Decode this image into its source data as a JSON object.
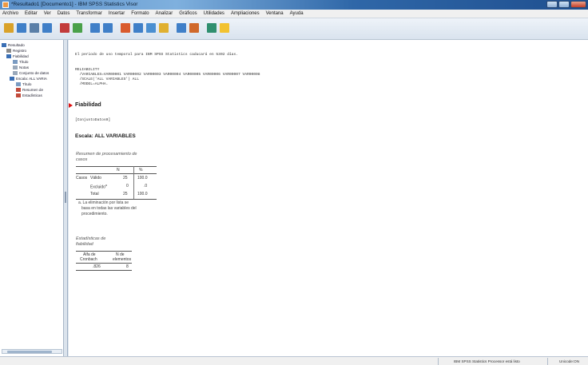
{
  "window": {
    "title": "*Resultado1 [Documento1] - IBM SPSS Statistics Visor",
    "controls": [
      "minimize",
      "maximize",
      "close"
    ]
  },
  "menu": [
    "Archivo",
    "Editar",
    "Ver",
    "Datos",
    "Transformar",
    "Insertar",
    "Formato",
    "Analizar",
    "Gráficos",
    "Utilidades",
    "Ampliaciones",
    "Ventana",
    "Ayuda"
  ],
  "toolbar": {
    "icons": [
      "open-icon",
      "save-icon",
      "print-icon",
      "print-preview-icon",
      "export-icon",
      "recall-dialog-icon",
      "undo-icon",
      "redo-icon",
      "goto-data-icon",
      "goto-case-icon",
      "variables-icon",
      "chart-icon",
      "select-cases-icon",
      "weight-icon",
      "show-all-icon",
      "new-output-icon"
    ],
    "colors": [
      "#d9a22a",
      "#3f7fc8",
      "#5a7fa8",
      "#3f7fc8",
      "#c23b3b",
      "#4aa14a",
      "#3f7fc8",
      "#3f7fc8",
      "#d95b2e",
      "#3f7fc8",
      "#4a8fd1",
      "#e0b030",
      "#3f7fc8",
      "#d0682a",
      "#2f8f6f",
      "#f2c230"
    ]
  },
  "nav": {
    "items": [
      {
        "label": "Resultado",
        "icon": "output-book-icon"
      },
      {
        "label": "Registro",
        "icon": "log-icon"
      },
      {
        "label": "Fiabilidad",
        "icon": "procedure-book-icon"
      },
      {
        "label": "Título",
        "icon": "title-icon"
      },
      {
        "label": "Notas",
        "icon": "notes-icon"
      },
      {
        "label": "Conjunto de datos",
        "icon": "dataset-icon"
      },
      {
        "label": "Escala: ALL VARIA",
        "icon": "scale-book-icon"
      },
      {
        "label": "Título",
        "icon": "title-icon"
      },
      {
        "label": "Resumen de",
        "icon": "table-icon"
      },
      {
        "label": "Estadísticas",
        "icon": "table-icon"
      }
    ]
  },
  "content": {
    "timer_line": "El periodo de uso temporal para IBM SPSS Statistics caducará en 5302 días.",
    "syntax": [
      "RELIABILITY",
      "  /VARIABLES=VAR00001 VAR00002 VAR00003 VAR00004 VAR00005 VAR00006 VAR00007 VAR00008",
      "  /SCALE('ALL VARIABLES') ALL",
      "  /MODEL=ALPHA."
    ],
    "section_title": "Fiabilidad",
    "dataset_label": "[ConjuntoDatos0]",
    "scale_title": "Escala: ALL VARIABLES",
    "summary": {
      "title_lines": [
        "Resumen de procesamiento de",
        "casos"
      ],
      "headers": [
        "N",
        "%"
      ],
      "group_label": "Casos",
      "rows": [
        {
          "label": "Válido",
          "sup": "",
          "n": "25",
          "pct": "100.0"
        },
        {
          "label": "Excluido",
          "sup": "a",
          "n": "0",
          "pct": ".0"
        },
        {
          "label": "Total",
          "sup": "",
          "n": "25",
          "pct": "100.0"
        }
      ],
      "footnote": [
        "a. La eliminación por lista se",
        "basa en todas las variables del",
        "procedimiento."
      ]
    },
    "reliability": {
      "title_lines": [
        "Estadísticas de",
        "fiabilidad"
      ],
      "headers": [
        [
          "Alfa de",
          "Cronbach"
        ],
        [
          "N de",
          "elementos"
        ]
      ],
      "values": [
        ".826",
        "8"
      ]
    }
  },
  "status": {
    "processor": "IBM SPSS Statistics Processor está listo",
    "encoding": "Unicode:ON"
  }
}
